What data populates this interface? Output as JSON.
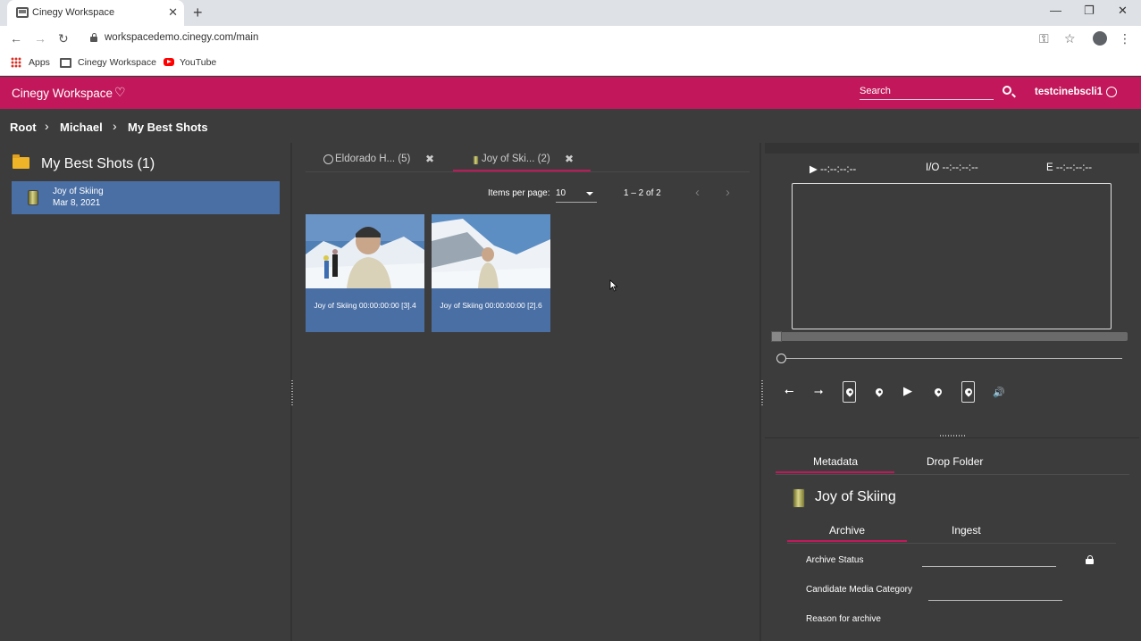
{
  "browser": {
    "tab_title": "Cinegy Workspace",
    "tab_close": "✕",
    "new_tab": "+",
    "url": "workspacedemo.cinegy.com/main",
    "bookmarks": [
      "Apps",
      "Cinegy Workspace",
      "YouTube"
    ],
    "window_controls": {
      "minimize": "—",
      "maximize": "❐",
      "close": "✕"
    }
  },
  "header": {
    "brand": "Cinegy Workspace",
    "heart": "♡",
    "search_placeholder": "Search",
    "username": "testcinebscli1"
  },
  "breadcrumb": [
    "Root",
    "Michael",
    "My Best Shots"
  ],
  "left_panel": {
    "folder_title": "My Best Shots (1)",
    "items": [
      {
        "name": "Joy of Skiing",
        "date": "Mar 8, 2021",
        "selected": true
      }
    ]
  },
  "content_tabs": [
    {
      "label": "Eldorado H... (5)",
      "icon": "globe-icon",
      "active": false
    },
    {
      "label": "Joy of Ski... (2)",
      "icon": "can-icon",
      "active": true
    }
  ],
  "pagination": {
    "items_per_page_label": "Items per page:",
    "items_per_page": "10",
    "range": "1 – 2 of 2"
  },
  "clips": [
    {
      "label": "Joy of Skiing 00:00:00:00 [3].4"
    },
    {
      "label": "Joy of Skiing 00:00:00:00 [2].6"
    }
  ],
  "player": {
    "play_tc": "▶ --:--:--:--",
    "io_tc": "I/O --:--:--:--",
    "end_tc": "E --:--:--:--"
  },
  "metadata": {
    "tabs": [
      "Metadata",
      "Drop Folder"
    ],
    "asset_title": "Joy of Skiing",
    "subtabs": [
      "Archive",
      "Ingest"
    ],
    "fields": [
      "Archive Status",
      "Candidate Media Category",
      "Reason for archive"
    ]
  },
  "colors": {
    "accent": "#c2185b",
    "selected": "#4a6fa5",
    "panel": "#3c3c3c"
  }
}
